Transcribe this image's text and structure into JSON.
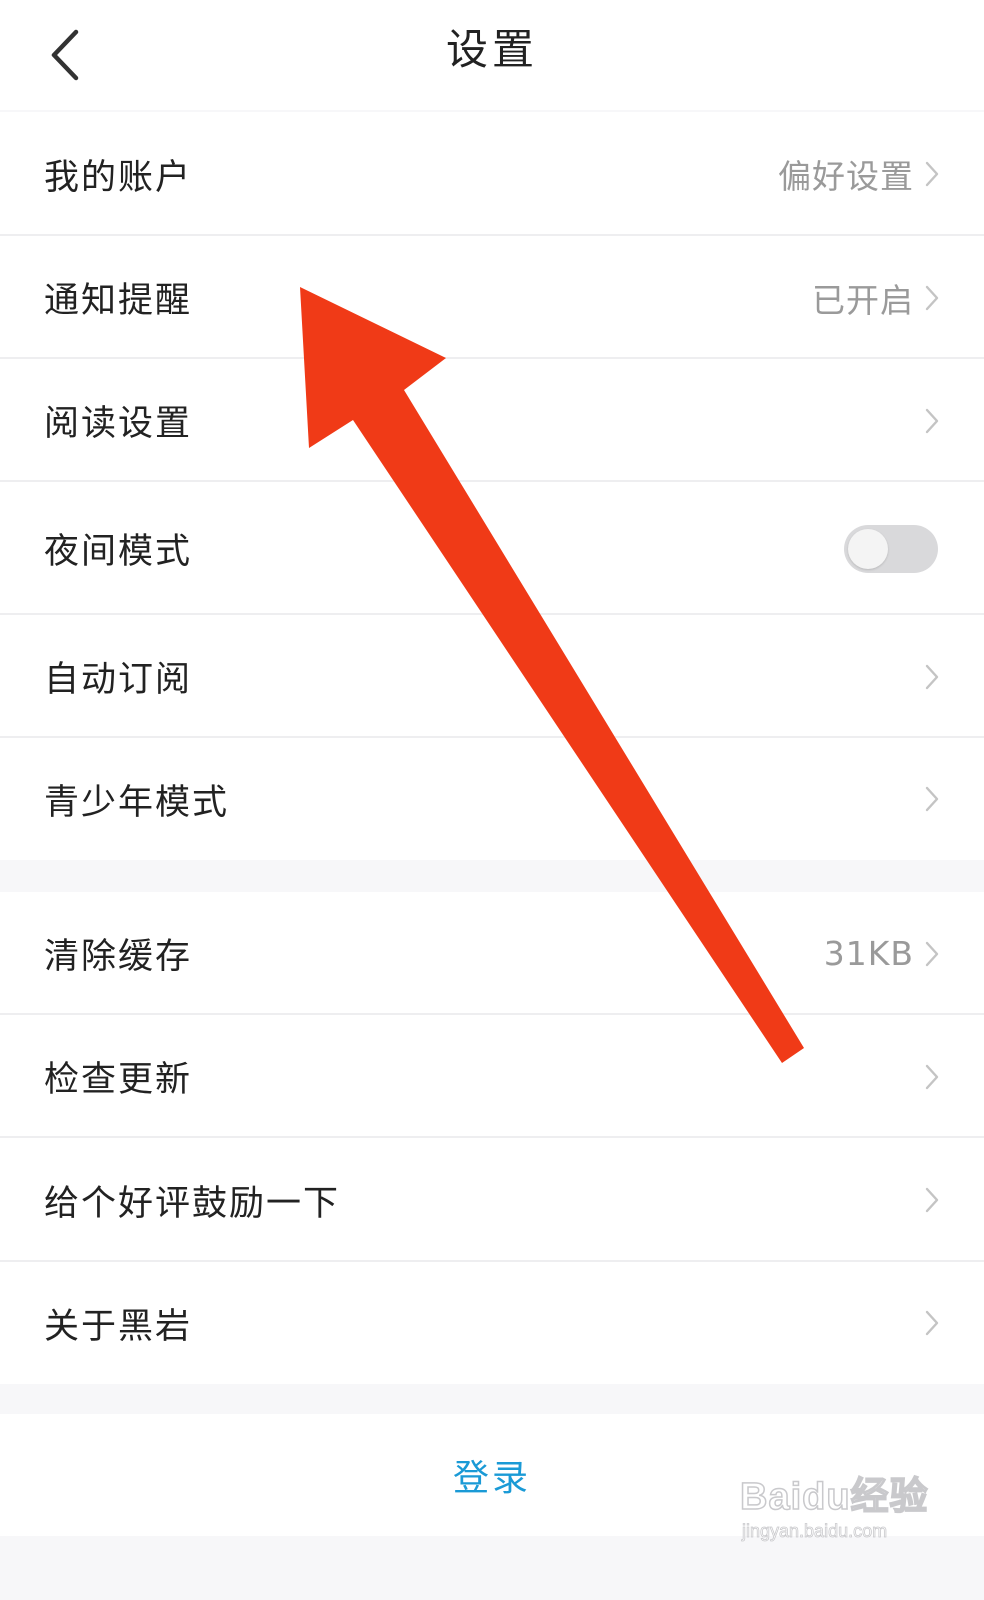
{
  "header": {
    "title": "设置",
    "back_icon": "chevron-left-icon"
  },
  "group1": [
    {
      "label": "我的账户",
      "value": "偏好设置",
      "control": "chevron"
    },
    {
      "label": "通知提醒",
      "value": "已开启",
      "control": "chevron"
    },
    {
      "label": "阅读设置",
      "value": "",
      "control": "chevron"
    },
    {
      "label": "夜间模式",
      "value": "",
      "control": "toggle",
      "toggle_on": false
    },
    {
      "label": "自动订阅",
      "value": "",
      "control": "chevron"
    },
    {
      "label": "青少年模式",
      "value": "",
      "control": "chevron"
    }
  ],
  "group2": [
    {
      "label": "清除缓存",
      "value": "31KB",
      "control": "chevron"
    },
    {
      "label": "检查更新",
      "value": "",
      "control": "chevron"
    },
    {
      "label": "给个好评鼓励一下",
      "value": "",
      "control": "chevron"
    },
    {
      "label": "关于黑岩",
      "value": "",
      "control": "chevron"
    }
  ],
  "login": {
    "label": "登录"
  },
  "watermark": {
    "logo": "Baidu经验",
    "url": "jingyan.baidu.com"
  },
  "colors": {
    "accent": "#1a9ad6",
    "arrow": "#f03a17",
    "toggle_off": "#d9d9db",
    "chevron": "#c4c4c4"
  }
}
